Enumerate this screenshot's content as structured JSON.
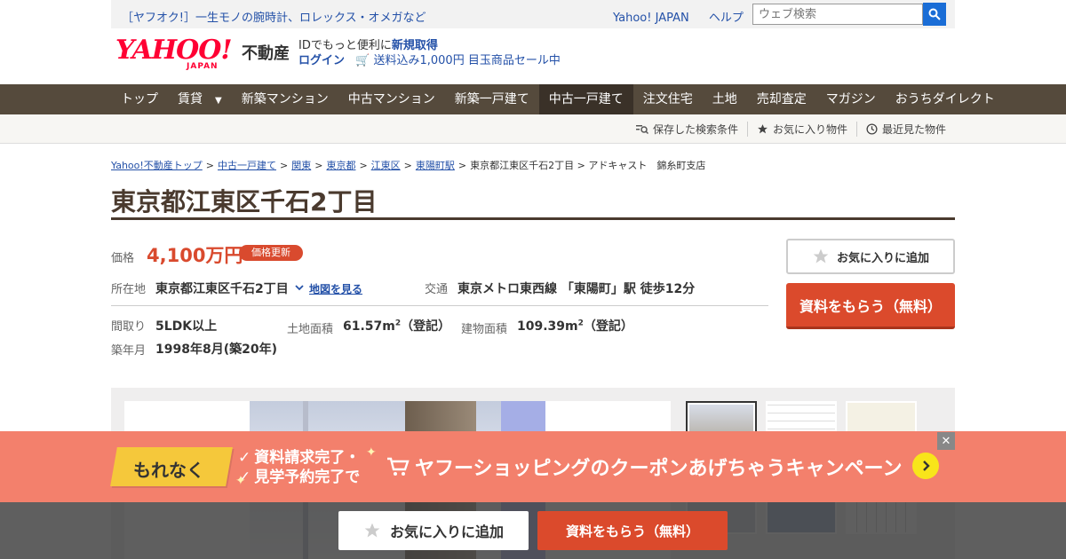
{
  "topbar": {
    "promo": "［ヤフオク!］一生モノの腕時計、ロレックス・オメガなど",
    "links": [
      "Yahoo! JAPAN",
      "ヘルプ"
    ],
    "search_placeholder": "ウェブ検索"
  },
  "header": {
    "logo_text": "YAHOO!",
    "logo_sub": "JAPAN",
    "service": "不動産",
    "id_text": "IDでもっと便利に",
    "signup": "新規取得",
    "login": "ログイン",
    "sale": "送料込み1,000円 目玉商品セール中"
  },
  "nav": {
    "items": [
      "トップ",
      "賃貸",
      "新築マンション",
      "中古マンション",
      "新築一戸建て",
      "中古一戸建て",
      "注文住宅",
      "土地",
      "売却査定",
      "マガジン",
      "おうちダイレクト"
    ],
    "caret": "▼",
    "active": "中古一戸建て"
  },
  "subnav": {
    "saved_search": "保存した検索条件",
    "favorites": "お気に入り物件",
    "recent": "最近見た物件"
  },
  "breadcrumb": {
    "links": [
      "Yahoo!不動産トップ",
      "中古一戸建て",
      "関東",
      "東京都",
      "江東区",
      "東陽町駅"
    ],
    "current": "東京都江東区千石2丁目 > アドキャスト　錦糸町支店",
    "sep": ">"
  },
  "property": {
    "title": "東京都江東区千石2丁目",
    "price_label": "価格",
    "price": "4,100万円",
    "price_badge": "価格更新",
    "location_label": "所在地",
    "location": "東京都江東区千石2丁目",
    "map_link": "地図を見る",
    "access_label": "交通",
    "access": "東京メトロ東西線 「東陽町」駅 徒歩12分",
    "layout_label": "間取り",
    "layout": "5LDK以上",
    "land_label": "土地面積",
    "land": "61.57m",
    "land_note": "（登記）",
    "building_label": "建物面積",
    "building": "109.39m",
    "building_note": "（登記）",
    "sq": "2",
    "built_label": "築年月",
    "built": "1998年8月(築20年)"
  },
  "actions": {
    "favorite": "お気に入りに追加",
    "request": "資料をもらう（無料）"
  },
  "banner": {
    "tag": "もれなく",
    "line1": "資料請求完了・",
    "line2": "見学予約完了で",
    "main": "ヤフーショッピングのクーポンあげちゃうキャンペーン",
    "close": "✕"
  },
  "bottom_bar": {
    "favorite": "お気に入りに追加",
    "request": "資料をもらう（無料）"
  },
  "colors": {
    "nav_bg": "#554a3c",
    "accent": "#db4a2c",
    "price": "#d94a2e",
    "link": "#2451a8",
    "banner": "#f3806c"
  }
}
